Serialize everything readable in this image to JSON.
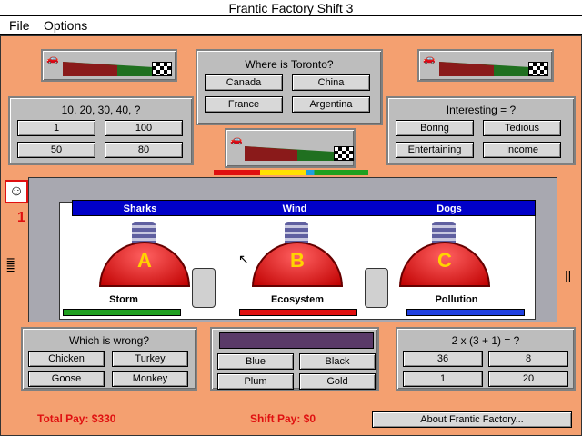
{
  "window": {
    "title": "Frantic Factory Shift 3"
  },
  "menu": {
    "items": [
      "File",
      "Options"
    ]
  },
  "player": {
    "lives": "1"
  },
  "questions": {
    "sequence": {
      "text": "10, 20, 30, 40, ?",
      "options": [
        "1",
        "100",
        "50",
        "80"
      ]
    },
    "geography": {
      "text": "Where is Toronto?",
      "options": [
        "Canada",
        "China",
        "France",
        "Argentina"
      ]
    },
    "synonym": {
      "text": "Interesting = ?",
      "options": [
        "Boring",
        "Tedious",
        "Entertaining",
        "Income"
      ]
    },
    "odd_one": {
      "text": "Which is wrong?",
      "options": [
        "Chicken",
        "Turkey",
        "Goose",
        "Monkey"
      ]
    },
    "colors": {
      "text": "",
      "options": [
        "Blue",
        "Black",
        "Plum",
        "Gold"
      ]
    },
    "math": {
      "text": "2 x (3 + 1) = ?",
      "options": [
        "36",
        "8",
        "1",
        "20"
      ]
    }
  },
  "machines": [
    {
      "letter": "A",
      "hood_label": "Sharks",
      "category": "Storm",
      "bar_color": "#20a020"
    },
    {
      "letter": "B",
      "hood_label": "Wind",
      "category": "Ecosystem",
      "bar_color": "#e01010"
    },
    {
      "letter": "C",
      "hood_label": "Dogs",
      "category": "Pollution",
      "bar_color": "#2040e0"
    }
  ],
  "progress": {
    "left_race": 0.85,
    "right_race": 0.85,
    "center_race": 0.85
  },
  "colors": {
    "accent": "#e01010",
    "belt": "#ffffff",
    "hood": "#0000c8"
  },
  "footer": {
    "total_pay": "Total Pay: $330",
    "shift_pay": "Shift Pay: $0",
    "about_button": "About Frantic Factory..."
  }
}
